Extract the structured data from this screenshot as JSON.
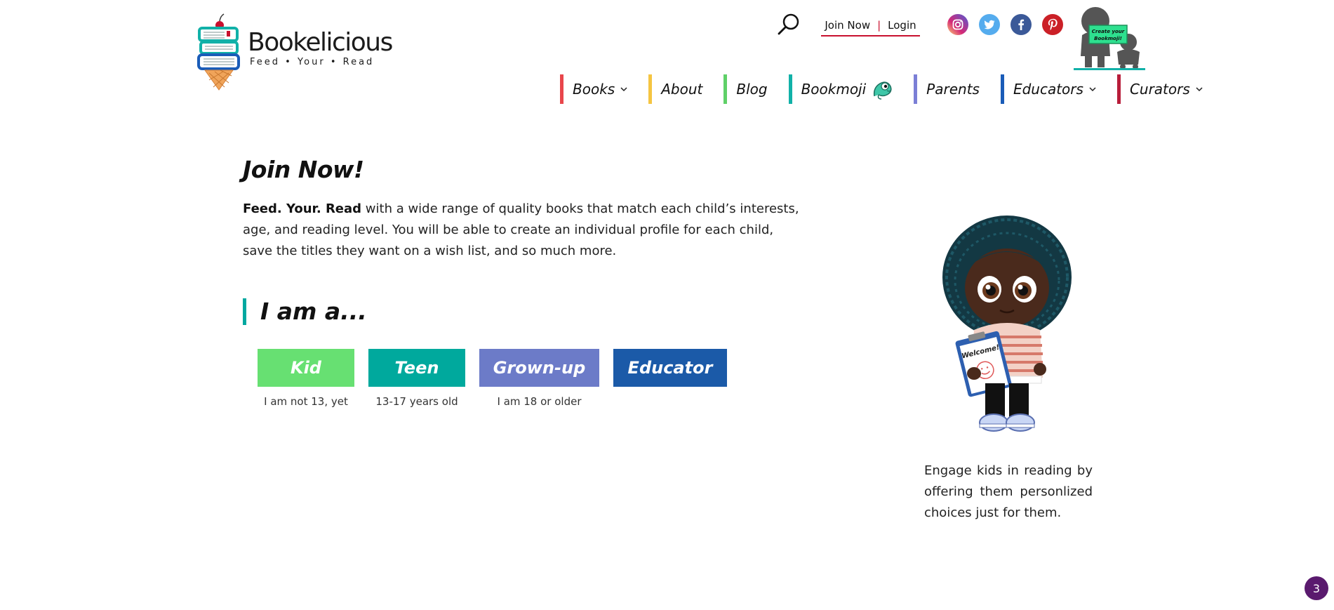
{
  "header": {
    "logo": {
      "title": "Bookelicious",
      "tagline": "Feed • Your • Read"
    },
    "auth": {
      "join": "Join Now",
      "separator": "|",
      "login": "Login"
    },
    "socials": [
      "instagram-icon",
      "twitter-icon",
      "facebook-icon",
      "pinterest-icon"
    ],
    "bookmoji_cta": "Create your Bookmoji!"
  },
  "nav": {
    "items": [
      {
        "label": "Books",
        "color": "#e8464b",
        "dropdown": true
      },
      {
        "label": "About",
        "color": "#f5c542",
        "dropdown": false
      },
      {
        "label": "Blog",
        "color": "#5fd068",
        "dropdown": false
      },
      {
        "label": "Bookmoji",
        "color": "#11b1a8",
        "dropdown": false,
        "mascot": true
      },
      {
        "label": "Parents",
        "color": "#7b7fd6",
        "dropdown": false
      },
      {
        "label": "Educators",
        "color": "#1a5cb8",
        "dropdown": true
      },
      {
        "label": "Curators",
        "color": "#b81d3a",
        "dropdown": true
      }
    ]
  },
  "main": {
    "title": "Join Now!",
    "intro_bold": "Feed. Your. Read",
    "intro_rest": " with a wide range of quality books that match each child’s interests, age, and reading level. You will be able to create an individual profile for each child, save the titles they want on a wish list, and so much more.",
    "iam": "I am a...",
    "roles": [
      {
        "label": "Kid",
        "desc": "I am not 13, yet",
        "color": "#67e072"
      },
      {
        "label": "Teen",
        "desc": "13-17 years old",
        "color": "#00a99d"
      },
      {
        "label": "Grown-up",
        "desc": "I am 18 or older",
        "color": "#6c7bc8"
      },
      {
        "label": "Educator",
        "desc": "",
        "color": "#1b5aa8"
      }
    ],
    "side_text": "Engage kids in reading by offering them personlized choices just for them.",
    "welcome_sign": "Welcome!"
  },
  "badge": "3"
}
